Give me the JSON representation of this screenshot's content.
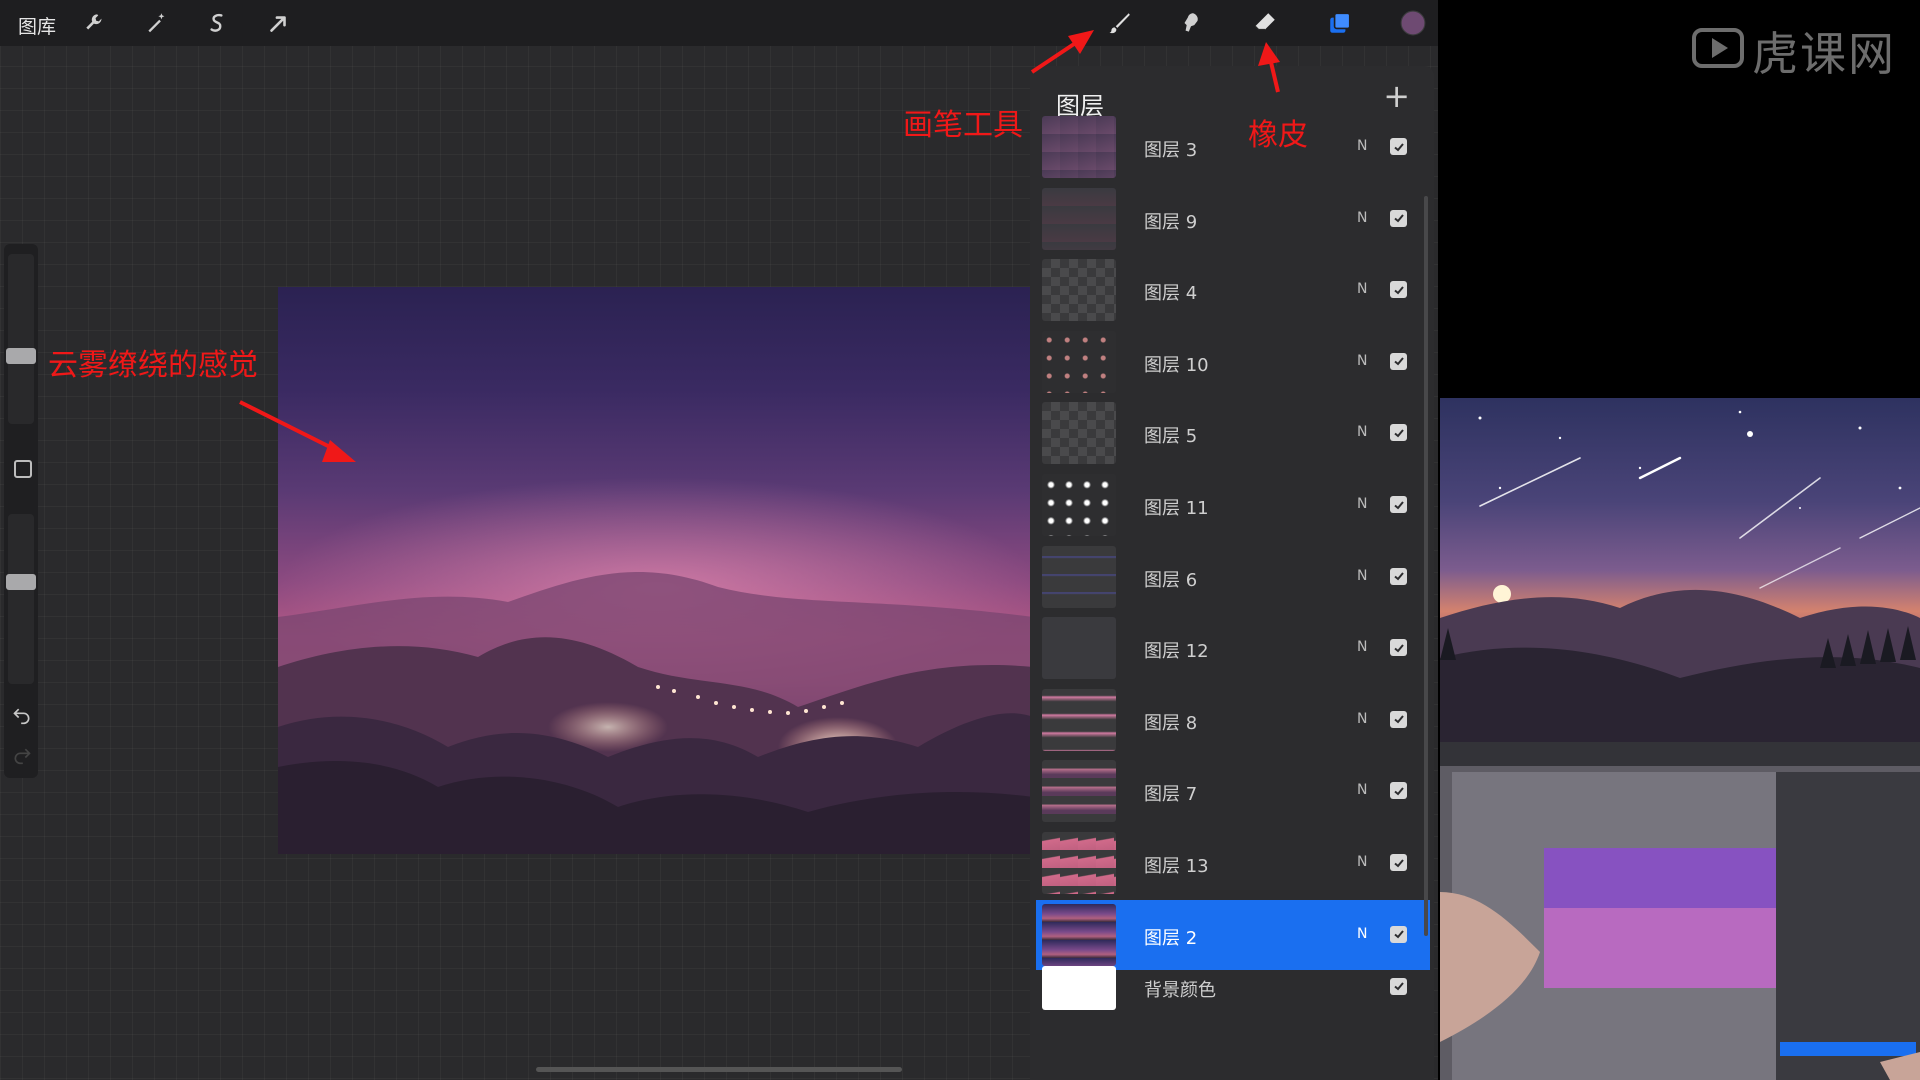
{
  "toolbar": {
    "gallery_label": "图库",
    "icons": [
      "wrench-icon",
      "magic-wand-icon",
      "selection-icon",
      "transform-arrow-icon",
      "brush-icon",
      "smudge-icon",
      "eraser-icon",
      "layers-icon",
      "color-icon"
    ],
    "color_swatch": "#6e4a72"
  },
  "annotations": {
    "brush_tool": "画笔工具",
    "eraser": "橡皮",
    "cloud_feel": "云雾缭绕的感觉"
  },
  "layers_panel": {
    "title": "图层",
    "add_label": "+",
    "layers": [
      {
        "name": "图层 3",
        "mode": "N",
        "visible": true
      },
      {
        "name": "图层 9",
        "mode": "N",
        "visible": true
      },
      {
        "name": "图层 4",
        "mode": "N",
        "visible": true
      },
      {
        "name": "图层 10",
        "mode": "N",
        "visible": true
      },
      {
        "name": "图层 5",
        "mode": "N",
        "visible": true
      },
      {
        "name": "图层 11",
        "mode": "N",
        "visible": true
      },
      {
        "name": "图层 6",
        "mode": "N",
        "visible": true
      },
      {
        "name": "图层 12",
        "mode": "N",
        "visible": true
      },
      {
        "name": "图层 8",
        "mode": "N",
        "visible": true
      },
      {
        "name": "图层 7",
        "mode": "N",
        "visible": true
      },
      {
        "name": "图层 13",
        "mode": "N",
        "visible": true
      },
      {
        "name": "图层 2",
        "mode": "N",
        "visible": true,
        "selected": true
      },
      {
        "name": "背景颜色",
        "mode": "",
        "visible": true
      }
    ]
  },
  "watermark": {
    "text": "虎课网"
  },
  "colors": {
    "accent": "#1a6ff0",
    "annotation": "#f01818",
    "panel": "#2c2c2e"
  }
}
